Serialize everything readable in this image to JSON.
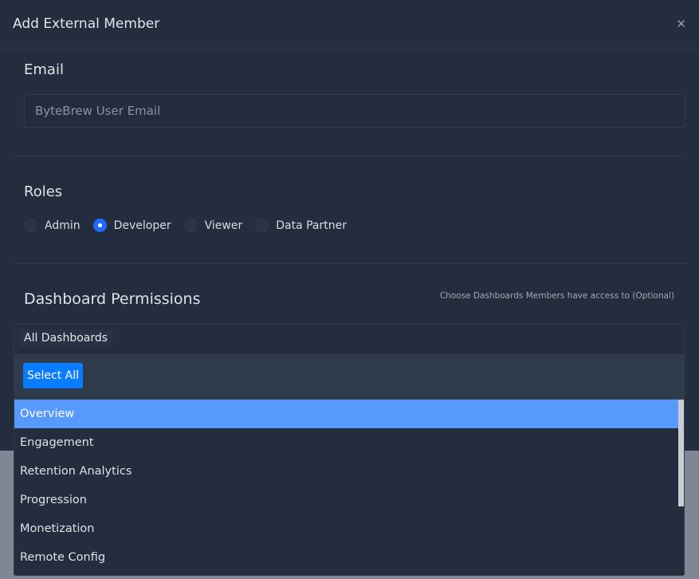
{
  "modal": {
    "title": "Add External Member",
    "close_icon": "close-icon"
  },
  "email": {
    "label": "Email",
    "placeholder": "ByteBrew User Email",
    "value": ""
  },
  "roles": {
    "label": "Roles",
    "options": [
      {
        "label": "Admin",
        "checked": false
      },
      {
        "label": "Developer",
        "checked": true
      },
      {
        "label": "Viewer",
        "checked": false
      },
      {
        "label": "Data Partner",
        "checked": false
      }
    ]
  },
  "permissions": {
    "label": "Dashboard Permissions",
    "hint": "Choose Dashboards Members have access to (Optional)",
    "selected_tag": "All Dashboards",
    "select_all": "Select All",
    "options": [
      "Overview",
      "Engagement",
      "Retention Analytics",
      "Progression",
      "Monetization",
      "Remote Config"
    ],
    "highlighted": "Overview"
  },
  "colors": {
    "accent": "#0a7cff",
    "highlight": "#5899fd",
    "modal_bg": "#232d3e"
  }
}
